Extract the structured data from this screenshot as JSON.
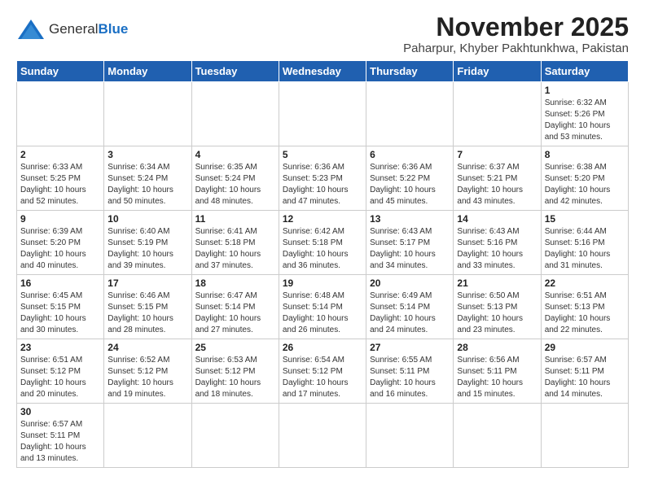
{
  "logo": {
    "general": "General",
    "blue": "Blue"
  },
  "header": {
    "month_year": "November 2025",
    "location": "Paharpur, Khyber Pakhtunkhwa, Pakistan"
  },
  "weekdays": [
    "Sunday",
    "Monday",
    "Tuesday",
    "Wednesday",
    "Thursday",
    "Friday",
    "Saturday"
  ],
  "weeks": [
    [
      {
        "day": "",
        "info": ""
      },
      {
        "day": "",
        "info": ""
      },
      {
        "day": "",
        "info": ""
      },
      {
        "day": "",
        "info": ""
      },
      {
        "day": "",
        "info": ""
      },
      {
        "day": "",
        "info": ""
      },
      {
        "day": "1",
        "info": "Sunrise: 6:32 AM\nSunset: 5:26 PM\nDaylight: 10 hours\nand 53 minutes."
      }
    ],
    [
      {
        "day": "2",
        "info": "Sunrise: 6:33 AM\nSunset: 5:25 PM\nDaylight: 10 hours\nand 52 minutes."
      },
      {
        "day": "3",
        "info": "Sunrise: 6:34 AM\nSunset: 5:24 PM\nDaylight: 10 hours\nand 50 minutes."
      },
      {
        "day": "4",
        "info": "Sunrise: 6:35 AM\nSunset: 5:24 PM\nDaylight: 10 hours\nand 48 minutes."
      },
      {
        "day": "5",
        "info": "Sunrise: 6:36 AM\nSunset: 5:23 PM\nDaylight: 10 hours\nand 47 minutes."
      },
      {
        "day": "6",
        "info": "Sunrise: 6:36 AM\nSunset: 5:22 PM\nDaylight: 10 hours\nand 45 minutes."
      },
      {
        "day": "7",
        "info": "Sunrise: 6:37 AM\nSunset: 5:21 PM\nDaylight: 10 hours\nand 43 minutes."
      },
      {
        "day": "8",
        "info": "Sunrise: 6:38 AM\nSunset: 5:20 PM\nDaylight: 10 hours\nand 42 minutes."
      }
    ],
    [
      {
        "day": "9",
        "info": "Sunrise: 6:39 AM\nSunset: 5:20 PM\nDaylight: 10 hours\nand 40 minutes."
      },
      {
        "day": "10",
        "info": "Sunrise: 6:40 AM\nSunset: 5:19 PM\nDaylight: 10 hours\nand 39 minutes."
      },
      {
        "day": "11",
        "info": "Sunrise: 6:41 AM\nSunset: 5:18 PM\nDaylight: 10 hours\nand 37 minutes."
      },
      {
        "day": "12",
        "info": "Sunrise: 6:42 AM\nSunset: 5:18 PM\nDaylight: 10 hours\nand 36 minutes."
      },
      {
        "day": "13",
        "info": "Sunrise: 6:43 AM\nSunset: 5:17 PM\nDaylight: 10 hours\nand 34 minutes."
      },
      {
        "day": "14",
        "info": "Sunrise: 6:43 AM\nSunset: 5:16 PM\nDaylight: 10 hours\nand 33 minutes."
      },
      {
        "day": "15",
        "info": "Sunrise: 6:44 AM\nSunset: 5:16 PM\nDaylight: 10 hours\nand 31 minutes."
      }
    ],
    [
      {
        "day": "16",
        "info": "Sunrise: 6:45 AM\nSunset: 5:15 PM\nDaylight: 10 hours\nand 30 minutes."
      },
      {
        "day": "17",
        "info": "Sunrise: 6:46 AM\nSunset: 5:15 PM\nDaylight: 10 hours\nand 28 minutes."
      },
      {
        "day": "18",
        "info": "Sunrise: 6:47 AM\nSunset: 5:14 PM\nDaylight: 10 hours\nand 27 minutes."
      },
      {
        "day": "19",
        "info": "Sunrise: 6:48 AM\nSunset: 5:14 PM\nDaylight: 10 hours\nand 26 minutes."
      },
      {
        "day": "20",
        "info": "Sunrise: 6:49 AM\nSunset: 5:14 PM\nDaylight: 10 hours\nand 24 minutes."
      },
      {
        "day": "21",
        "info": "Sunrise: 6:50 AM\nSunset: 5:13 PM\nDaylight: 10 hours\nand 23 minutes."
      },
      {
        "day": "22",
        "info": "Sunrise: 6:51 AM\nSunset: 5:13 PM\nDaylight: 10 hours\nand 22 minutes."
      }
    ],
    [
      {
        "day": "23",
        "info": "Sunrise: 6:51 AM\nSunset: 5:12 PM\nDaylight: 10 hours\nand 20 minutes."
      },
      {
        "day": "24",
        "info": "Sunrise: 6:52 AM\nSunset: 5:12 PM\nDaylight: 10 hours\nand 19 minutes."
      },
      {
        "day": "25",
        "info": "Sunrise: 6:53 AM\nSunset: 5:12 PM\nDaylight: 10 hours\nand 18 minutes."
      },
      {
        "day": "26",
        "info": "Sunrise: 6:54 AM\nSunset: 5:12 PM\nDaylight: 10 hours\nand 17 minutes."
      },
      {
        "day": "27",
        "info": "Sunrise: 6:55 AM\nSunset: 5:11 PM\nDaylight: 10 hours\nand 16 minutes."
      },
      {
        "day": "28",
        "info": "Sunrise: 6:56 AM\nSunset: 5:11 PM\nDaylight: 10 hours\nand 15 minutes."
      },
      {
        "day": "29",
        "info": "Sunrise: 6:57 AM\nSunset: 5:11 PM\nDaylight: 10 hours\nand 14 minutes."
      }
    ],
    [
      {
        "day": "30",
        "info": "Sunrise: 6:57 AM\nSunset: 5:11 PM\nDaylight: 10 hours\nand 13 minutes."
      },
      {
        "day": "",
        "info": ""
      },
      {
        "day": "",
        "info": ""
      },
      {
        "day": "",
        "info": ""
      },
      {
        "day": "",
        "info": ""
      },
      {
        "day": "",
        "info": ""
      },
      {
        "day": "",
        "info": ""
      }
    ]
  ]
}
